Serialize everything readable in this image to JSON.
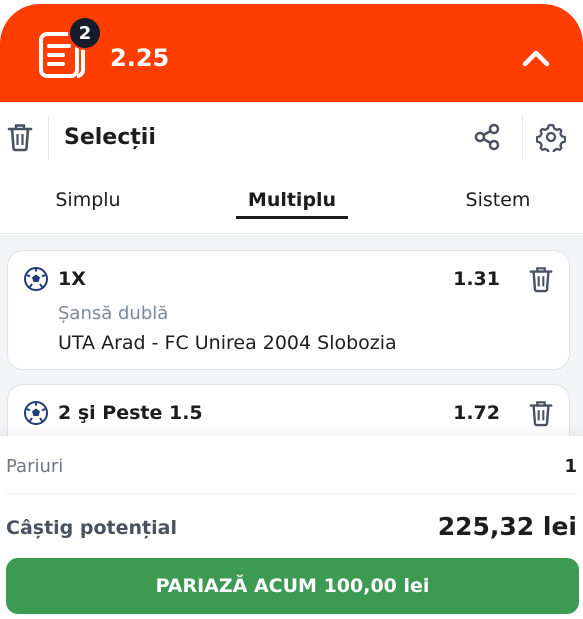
{
  "header": {
    "selection_count": "2",
    "total_odds": "2.25",
    "slip_icon": "betslip-icon",
    "collapse_icon": "chevron-up-icon",
    "accent_color": "#ff3d00"
  },
  "toolbar": {
    "title": "Selecții",
    "icons": [
      "trash-icon",
      "share-icon",
      "gear-icon"
    ]
  },
  "tabs": {
    "items": [
      "Simplu",
      "Multiplu",
      "Sistem"
    ],
    "active": "Multiplu"
  },
  "selections": [
    {
      "pick": "1X",
      "odds": "1.31",
      "market": "Șansă dublă",
      "match": "UTA Arad - FC Unirea 2004 Slobozia",
      "sport_icon": "football-icon"
    },
    {
      "pick": "2 şi Peste 1.5",
      "odds": "1.72",
      "sport_icon": "football-icon"
    }
  ],
  "summary": {
    "bets_label": "Pariuri",
    "bets_value": "1",
    "potential_label": "Câștig potențial",
    "potential_value": "225,32 lei",
    "place_button": "PARIAZĂ ACUM 100,00 lei",
    "button_color": "#3d9a52"
  }
}
